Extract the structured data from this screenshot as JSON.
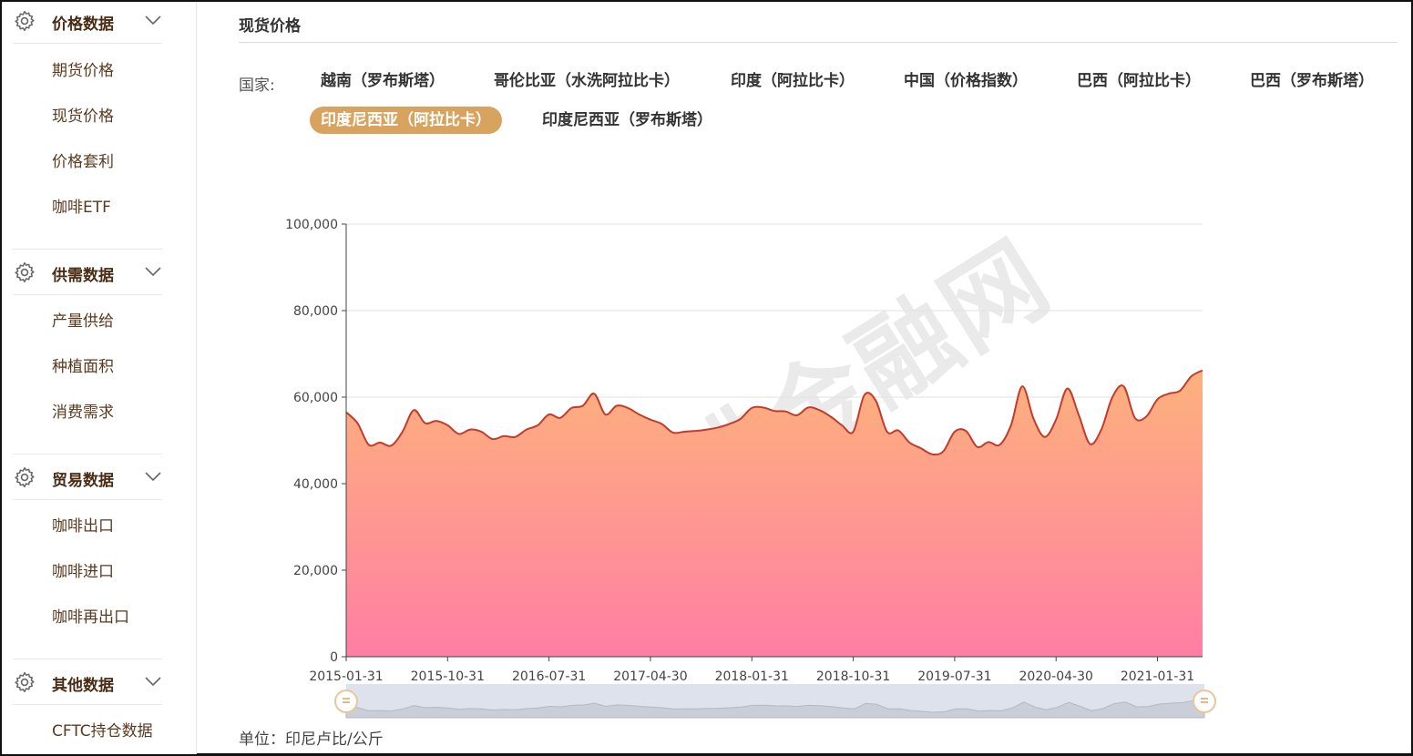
{
  "sidebar": {
    "groups": [
      {
        "title": "价格数据",
        "items": [
          "期货价格",
          "现货价格",
          "价格套利",
          "咖啡ETF"
        ]
      },
      {
        "title": "供需数据",
        "items": [
          "产量供给",
          "种植面积",
          "消费需求"
        ]
      },
      {
        "title": "贸易数据",
        "items": [
          "咖啡出口",
          "咖啡进口",
          "咖啡再出口"
        ]
      },
      {
        "title": "其他数据",
        "items": [
          "CFTC持仓数据"
        ]
      }
    ]
  },
  "main": {
    "title": "现货价格",
    "country_label": "国家:",
    "countries": [
      "越南（罗布斯塔）",
      "哥伦比亚（水洗阿拉比卡）",
      "印度（阿拉比卡）",
      "中国（价格指数）",
      "巴西（阿拉比卡）",
      "巴西（罗布斯塔）",
      "印度尼西亚（阿拉比卡）",
      "印度尼西亚（罗布斯塔）"
    ],
    "active_country": "印度尼西亚（阿拉比卡）",
    "unit": "单位：印尼卢比/公斤",
    "watermark": "咖啡金融网"
  },
  "colors": {
    "accent": "#d8a35f",
    "line": "#c23b2d",
    "area_top": "#fdb27c",
    "area_bottom": "#ff7ea4",
    "slider_bg": "#dde2ec"
  },
  "chart_data": {
    "type": "area",
    "x_ticks": [
      "2015-01-31",
      "2015-10-31",
      "2016-07-31",
      "2017-04-30",
      "2018-01-31",
      "2018-10-31",
      "2019-07-31",
      "2020-04-30",
      "2021-01-31"
    ],
    "y_ticks": [
      "0",
      "20,000",
      "40,000",
      "60,000",
      "80,000",
      "100,000"
    ],
    "ylim": [
      0,
      100000
    ],
    "xlabel": "",
    "ylabel": "",
    "grid": true,
    "data_zoom": true,
    "x": [
      "2015-01",
      "2015-02",
      "2015-03",
      "2015-04",
      "2015-05",
      "2015-06",
      "2015-07",
      "2015-08",
      "2015-09",
      "2015-10",
      "2015-11",
      "2015-12",
      "2016-01",
      "2016-02",
      "2016-03",
      "2016-04",
      "2016-05",
      "2016-06",
      "2016-07",
      "2016-08",
      "2016-09",
      "2016-10",
      "2016-11",
      "2016-12",
      "2017-01",
      "2017-02",
      "2017-03",
      "2017-04",
      "2017-05",
      "2017-06",
      "2017-07",
      "2017-08",
      "2017-09",
      "2017-10",
      "2017-11",
      "2017-12",
      "2018-01",
      "2018-02",
      "2018-03",
      "2018-04",
      "2018-05",
      "2018-06",
      "2018-07",
      "2018-08",
      "2018-09",
      "2018-10",
      "2018-11",
      "2018-12",
      "2019-01",
      "2019-02",
      "2019-03",
      "2019-04",
      "2019-05",
      "2019-06",
      "2019-07",
      "2019-08",
      "2019-09",
      "2019-10",
      "2019-11",
      "2019-12",
      "2020-01",
      "2020-02",
      "2020-03",
      "2020-04",
      "2020-05",
      "2020-06",
      "2020-07",
      "2020-08",
      "2020-09",
      "2020-10",
      "2020-11",
      "2020-12",
      "2021-01",
      "2021-02",
      "2021-03",
      "2021-04",
      "2021-05"
    ],
    "values": [
      56500,
      54000,
      49000,
      49500,
      48800,
      52000,
      57000,
      54000,
      54500,
      53500,
      51500,
      52500,
      52000,
      50300,
      51000,
      50800,
      52500,
      53500,
      56000,
      55200,
      57500,
      58000,
      60800,
      56000,
      58000,
      57500,
      56000,
      54800,
      53800,
      51800,
      52000,
      52200,
      52500,
      53000,
      53800,
      55000,
      57500,
      57600,
      56800,
      56700,
      55800,
      57600,
      57000,
      55500,
      53500,
      52000,
      60500,
      59200,
      52000,
      52300,
      49500,
      48200,
      46800,
      47500,
      52000,
      52200,
      48500,
      49600,
      49000,
      53500,
      62500,
      55000,
      50800,
      54800,
      62000,
      56000,
      49200,
      52400,
      60000,
      62500,
      55200,
      55500,
      59500,
      60800,
      61500,
      64800,
      66200
    ]
  }
}
